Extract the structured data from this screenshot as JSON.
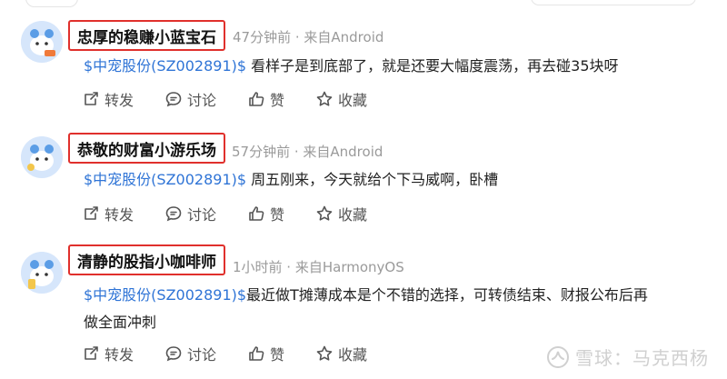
{
  "posts": [
    {
      "author": "忠厚的稳赚小蓝宝石",
      "meta": "47分钟前 · 来自Android",
      "stock": "$中宠股份(SZ002891)$",
      "text": " 看样子是到底部了，就是还要大幅度震荡，再去碰35块呀",
      "text2": ""
    },
    {
      "author": "恭敬的财富小游乐场",
      "meta": "57分钟前 · 来自Android",
      "stock": "$中宠股份(SZ002891)$",
      "text": " 周五刚来，今天就给个下马威啊，卧槽",
      "text2": ""
    },
    {
      "author": "清静的股指小咖啡师",
      "meta": "1小时前 · 来自HarmonyOS",
      "stock": "$中宠股份(SZ002891)$",
      "text": "最近做T摊薄成本是个不错的选择，可转债结束、财报公布后再",
      "text2": "做全面冲刺"
    }
  ],
  "actions": {
    "repost": "转发",
    "comment": "讨论",
    "like": "赞",
    "favorite": "收藏"
  },
  "icons": [
    "repost-icon",
    "comment-icon",
    "like-icon",
    "favorite-icon",
    "snowball-logo-icon"
  ],
  "watermark": "雪球：马克西杨",
  "colors": {
    "link": "#2f74d6",
    "highlight_border": "#e0302c",
    "meta": "#9a9a9a"
  }
}
